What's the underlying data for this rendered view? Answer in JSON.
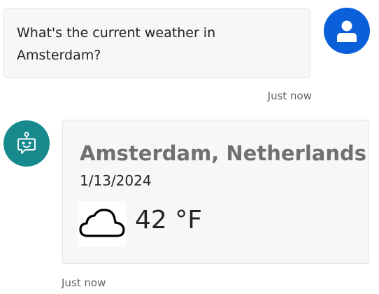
{
  "user_message": {
    "text": "What's the current weather in Amsterdam?",
    "timestamp": "Just now",
    "avatar_icon": "person-icon",
    "avatar_color": "#0a60d9"
  },
  "bot_message": {
    "avatar_icon": "bot-icon",
    "avatar_color": "#188a8e",
    "card": {
      "city": "Amsterdam, Netherlands",
      "date": "1/13/2024",
      "weather_icon": "cloud-icon",
      "temperature": "42 °F"
    },
    "timestamp": "Just now"
  }
}
